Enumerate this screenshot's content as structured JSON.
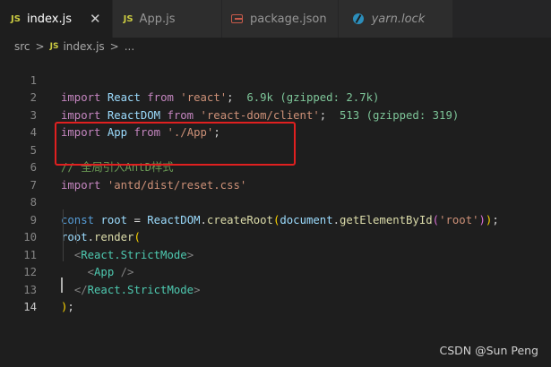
{
  "tabs": [
    {
      "icon": "JS",
      "label": "index.js",
      "close": "✕"
    },
    {
      "icon": "JS",
      "label": "App.js"
    },
    {
      "icon": "json-icon",
      "label": "package.json"
    },
    {
      "icon": "yarn-icon",
      "label": "yarn.lock"
    }
  ],
  "breadcrumb": {
    "folder": "src",
    "sep": ">",
    "file_icon": "JS",
    "file": "index.js",
    "more": "..."
  },
  "lines": [
    {
      "num": "1"
    },
    {
      "num": "2"
    },
    {
      "num": "3"
    },
    {
      "num": "4"
    },
    {
      "num": "5"
    },
    {
      "num": "6"
    },
    {
      "num": "7"
    },
    {
      "num": "8"
    },
    {
      "num": "9"
    },
    {
      "num": "10"
    },
    {
      "num": "11"
    },
    {
      "num": "12"
    },
    {
      "num": "13"
    },
    {
      "num": "14"
    }
  ],
  "code": {
    "import_kw": "import",
    "from_kw": "from",
    "const_kw": "const",
    "react_id": "React",
    "react_str": "'react'",
    "react_size": "6.9k (gzipped: 2.7k)",
    "reactdom_id": "ReactDOM",
    "reactdom_str": "'react-dom/client'",
    "reactdom_size": "513 (gzipped: 319)",
    "app_id": "App",
    "app_str": "'./App'",
    "comment": "// 全局引入AntD样式",
    "antd_str": "'antd/dist/reset.css'",
    "root_id": "root",
    "create_root": "createRoot",
    "document_id": "document",
    "get_el": "getElementById",
    "root_str": "'root'",
    "render": "render",
    "strict_mode": "React.StrictMode",
    "app_tag": "App"
  },
  "watermark": "CSDN @Sun   Peng",
  "colors": {
    "background": "#1e1e1e",
    "highlight_border": "#e02020",
    "keyword": "#c586c0",
    "variable": "#9cdcfe",
    "string": "#ce9178",
    "comment": "#6a9955",
    "jsx_tag": "#4ec9b0",
    "function": "#dcdcaa"
  }
}
